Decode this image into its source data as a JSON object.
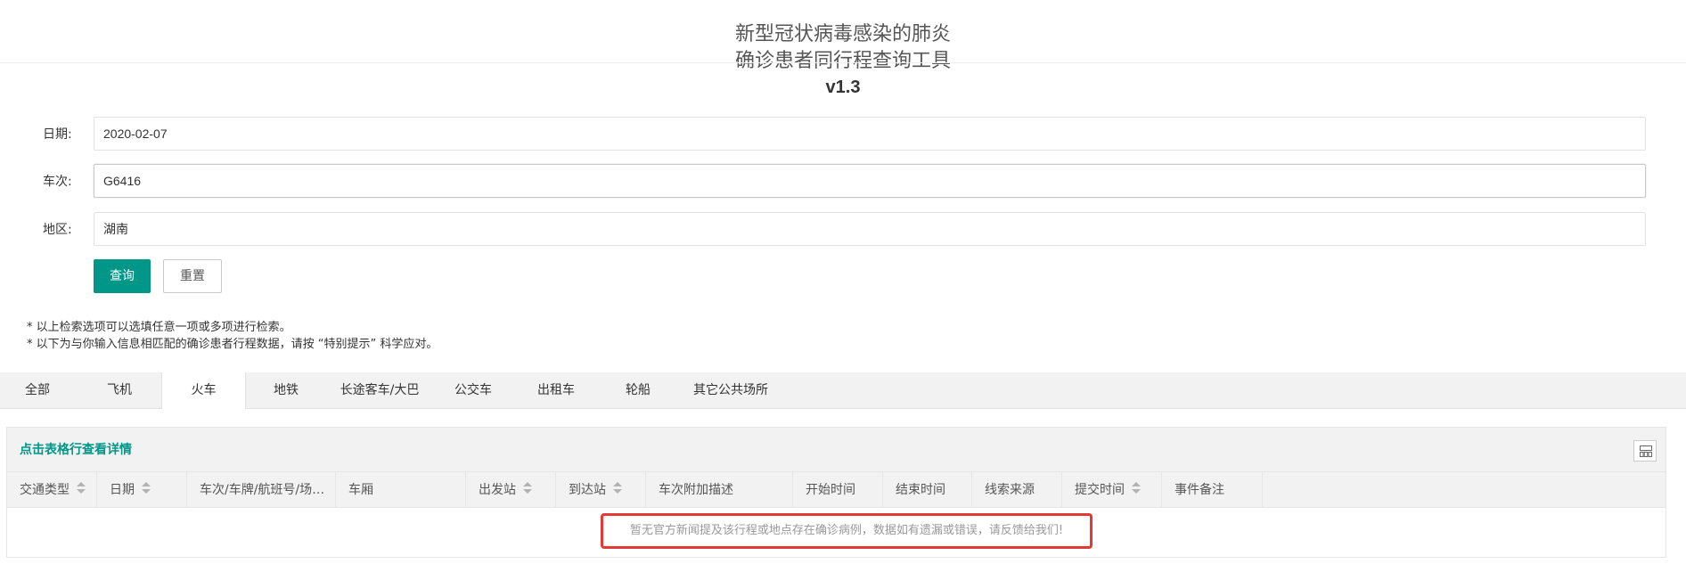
{
  "header": {
    "title_line1": "新型冠状病毒感染的肺炎",
    "title_line2": "确诊患者同行程查询工具",
    "version": "v1.3"
  },
  "form": {
    "date": {
      "label": "日期:",
      "value": "2020-02-07"
    },
    "train": {
      "label": "车次:",
      "value": "G6416"
    },
    "region": {
      "label": "地区:",
      "value": "湖南"
    },
    "query_label": "查询",
    "reset_label": "重置"
  },
  "notes": [
    "* 以上检索选项可以选填任意一项或多项进行检索。",
    "* 以下为与你输入信息相匹配的确诊患者行程数据，请按 “特别提示” 科学应对。"
  ],
  "tabs": [
    {
      "label": "全部"
    },
    {
      "label": "飞机"
    },
    {
      "label": "火车",
      "active": true
    },
    {
      "label": "地铁"
    },
    {
      "label": "长途客车/大巴"
    },
    {
      "label": "公交车"
    },
    {
      "label": "出租车"
    },
    {
      "label": "轮船"
    },
    {
      "label": "其它公共场所"
    }
  ],
  "table": {
    "hint": "点击表格行查看详情",
    "columns_icon": "columns-icon",
    "columns": [
      {
        "label": "交通类型",
        "sortable": true
      },
      {
        "label": "日期",
        "sortable": true
      },
      {
        "label": "车次/车牌/航班号/场所名...",
        "sortable": false
      },
      {
        "label": "车厢",
        "sortable": false
      },
      {
        "label": "出发站",
        "sortable": true
      },
      {
        "label": "到达站",
        "sortable": true
      },
      {
        "label": "车次附加描述",
        "sortable": false
      },
      {
        "label": "开始时间",
        "sortable": false
      },
      {
        "label": "结束时间",
        "sortable": false
      },
      {
        "label": "线索来源",
        "sortable": false
      },
      {
        "label": "提交时间",
        "sortable": true
      },
      {
        "label": "事件备注",
        "sortable": false
      }
    ],
    "empty_message": "暂无官方新闻提及该行程或地点存在确诊病例，数据如有遗漏或错误，请反馈给我们!"
  },
  "colors": {
    "primary": "#009688",
    "highlight_border": "#e53935"
  }
}
